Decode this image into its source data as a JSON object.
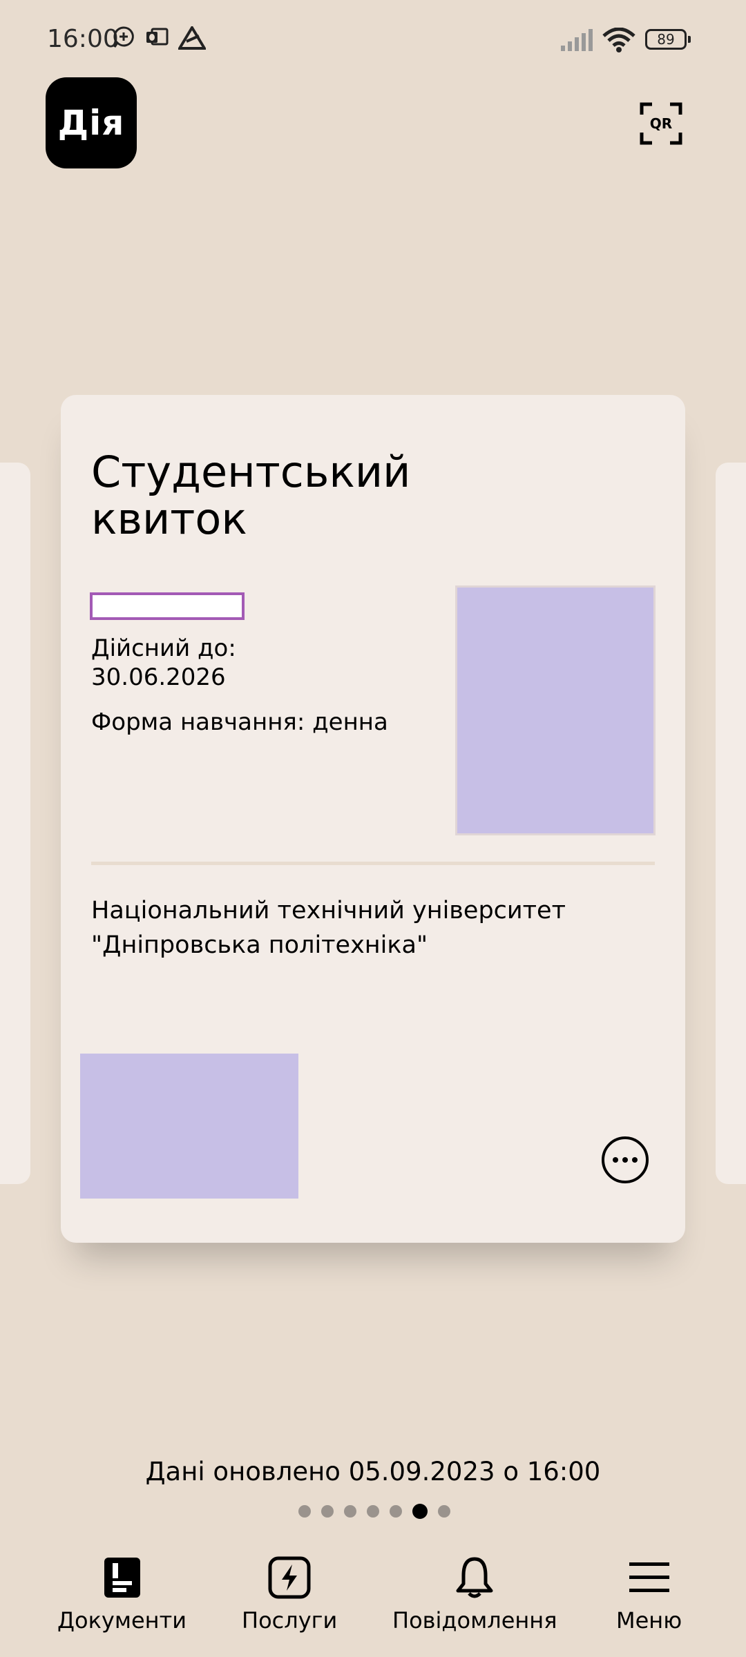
{
  "status_bar": {
    "time": "16:00",
    "battery": "89",
    "icons": [
      "notification-icon",
      "outlook-icon",
      "app-icon",
      "signal-icon",
      "wifi-icon",
      "battery-icon"
    ]
  },
  "header": {
    "logo_text": "Дія",
    "qr_label": "QR"
  },
  "card": {
    "title": "Студентський квиток",
    "valid_until": "Дійсний до: 30.06.2026",
    "study_form": "Форма навчання: денна",
    "university": "Національний технічний університет \"Дніпровська політехніка\"",
    "more_icon": "more-icon"
  },
  "updated_text": "Дані оновлено 05.09.2023 о 16:00",
  "pagination": {
    "total": 7,
    "active_index": 5
  },
  "bottom_nav": {
    "items": [
      {
        "label": "Документи",
        "icon": "documents-icon"
      },
      {
        "label": "Послуги",
        "icon": "services-icon"
      },
      {
        "label": "Повідомлення",
        "icon": "bell-icon"
      },
      {
        "label": "Меню",
        "icon": "menu-icon"
      }
    ]
  }
}
